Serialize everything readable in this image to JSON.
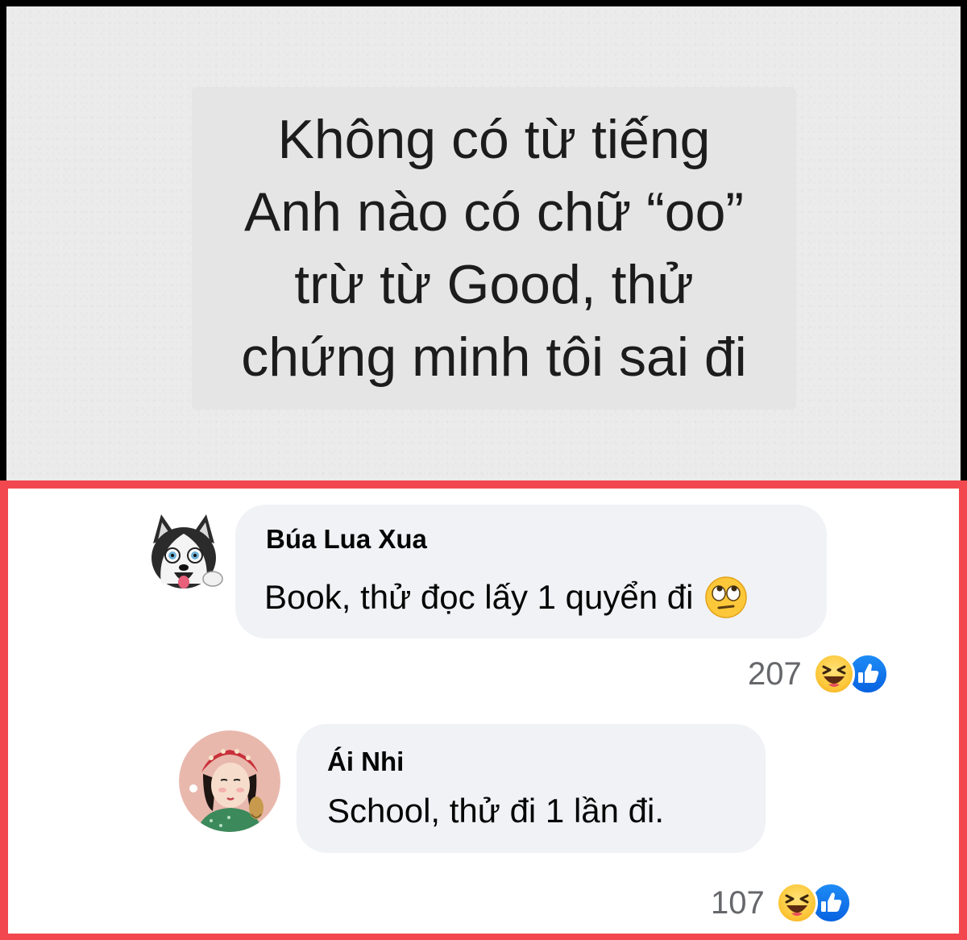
{
  "quote": {
    "lines": [
      "Không có từ tiếng",
      "Anh nào có chữ “oo”",
      "trừ từ Good, thử",
      "chứng minh tôi sai đi"
    ]
  },
  "comments": [
    {
      "author": "Búa Lua Xua",
      "text": "Book, thử đọc lấy 1 quyển đi",
      "emoji": "rolling-eyes-emoji",
      "reaction_count": "207",
      "reactions": [
        "haha-reaction-icon",
        "like-reaction-icon"
      ],
      "avatar": "husky-avatar"
    },
    {
      "author": "Ái Nhi",
      "text": "School, thử đi 1 lần đi.",
      "reaction_count": "107",
      "reactions": [
        "haha-reaction-icon",
        "like-reaction-icon"
      ],
      "avatar": "illustrated-woman-avatar"
    }
  ],
  "colors": {
    "highlight_border": "#f2474e",
    "bubble": "#f0f2f5",
    "like_blue": "#1877f2",
    "haha_yellow": "#fcc83a"
  }
}
